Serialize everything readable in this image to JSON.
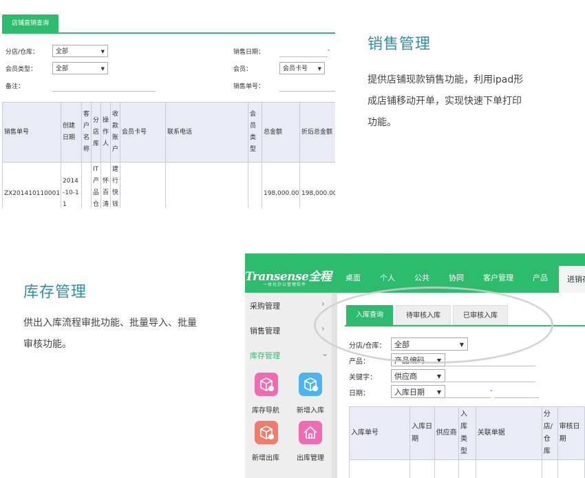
{
  "section1": {
    "title": "销售管理",
    "description_lines": [
      "提供店铺现款销售功能，利用ipad形",
      "成店铺移动开单，实现快速下单打印",
      "功能。"
    ]
  },
  "section2": {
    "title": "库存管理",
    "description_lines": [
      "供出入库流程审批功能、批量导入、批量",
      "审核功能。"
    ]
  },
  "shot1": {
    "tab_label": "店铺直销查询",
    "form": {
      "branch_label": "分店/仓库：",
      "branch_value": "全部",
      "member_type_label": "会员类型：",
      "member_type_value": "全部",
      "note_label": "备注：",
      "sale_date_label": "销售日期：",
      "sale_date_sep": "-",
      "member_label": "会员：",
      "member_value": "会员卡号",
      "sale_no_label": "销售单号："
    },
    "table": {
      "headers": [
        "销售单号",
        "创建日期",
        "客户名称",
        "分店库",
        "操作人",
        "收款账户",
        "会员卡号",
        "联系电话",
        "会员类型",
        "总金额",
        "折后总金额"
      ],
      "rows": [
        [
          "ZX201410110001",
          "2014-10-11",
          "",
          "IT产品仓库",
          "怀百涛",
          "建行快钱自",
          "",
          "",
          "",
          "198,000.00",
          "198,000.00"
        ]
      ]
    }
  },
  "shot2": {
    "logo": "Transense全程",
    "logo_sub": "一体化办公管理软件",
    "nav": [
      "桌面",
      "个人",
      "公共",
      "协同",
      "客户管理",
      "产品",
      "进销存"
    ],
    "sidebar": {
      "menus": [
        "采购管理",
        "销售管理",
        "库存管理"
      ],
      "apps": [
        {
          "label": "库存导航",
          "icon": "box-icon",
          "color": "#f06bb0"
        },
        {
          "label": "新增入库",
          "icon": "box-add-icon",
          "color": "#4cb4f0"
        },
        {
          "label": "新增出库",
          "icon": "box-out-icon",
          "color": "#f07c6e"
        },
        {
          "label": "出库管理",
          "icon": "house-icon",
          "color": "#f06bb0"
        }
      ]
    },
    "tabs": [
      "入库查询",
      "待审核入库",
      "已审核入库"
    ],
    "form": {
      "branch_label": "分店/仓库：",
      "branch_value": "全部",
      "product_label": "产品：",
      "product_value": "产品编码",
      "keyword_label": "关键字：",
      "keyword_value": "供应商",
      "date_label": "日期：",
      "date_value": "入库日期",
      "date_sep": "-"
    },
    "table": {
      "headers": [
        "入库单号",
        "入库日期",
        "供应商",
        "入库类型",
        "关联单据",
        "分店/仓库",
        "审核日期"
      ]
    }
  },
  "colors": {
    "green": "#2dbc6e",
    "title_teal": "#2e8fa0",
    "header_bg": "#e9ebf5"
  }
}
